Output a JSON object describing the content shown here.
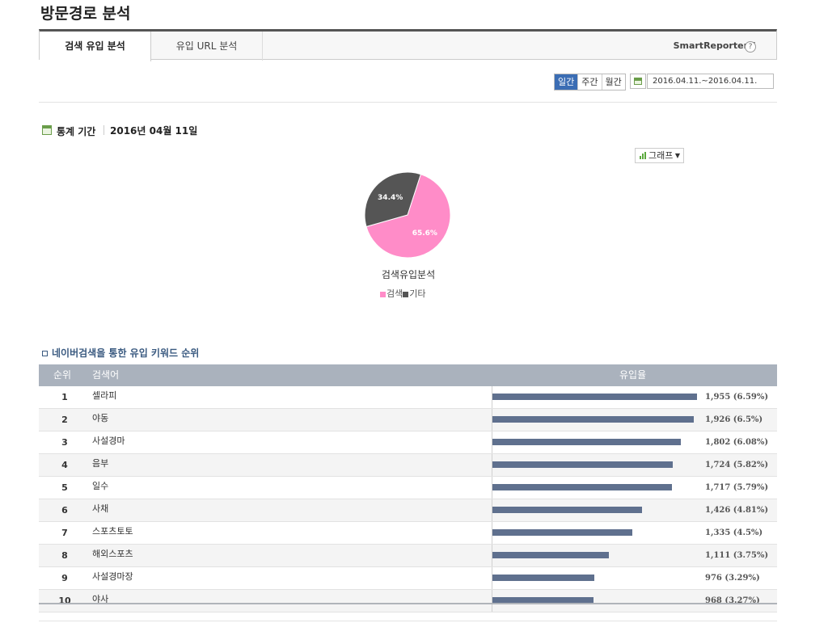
{
  "page": {
    "title": "방문경로 분석"
  },
  "tabs": [
    {
      "label": "검색 유입 분석",
      "active": true
    },
    {
      "label": "유입 URL 분석",
      "active": false
    }
  ],
  "smart_reporter": {
    "label": "SmartReporter™",
    "help": "?"
  },
  "period": {
    "buttons": [
      {
        "label": "일간",
        "selected": true
      },
      {
        "label": "주간",
        "selected": false
      },
      {
        "label": "월간",
        "selected": false
      }
    ],
    "date_range": "2016.04.11.~2016.04.11."
  },
  "stats": {
    "label": "통계 기간",
    "date": "2016년 04월 11일"
  },
  "graph_toggle": {
    "label": "그래프",
    "icon": "bar-chart-icon"
  },
  "chart_data": {
    "type": "pie",
    "title": "검색유입분석",
    "series": [
      {
        "name": "검색",
        "value": 65.6,
        "label": "65.6%",
        "color": "#ff8cc8"
      },
      {
        "name": "기타",
        "value": 34.4,
        "label": "34.4%",
        "color": "#555555"
      }
    ]
  },
  "keywords": {
    "title": "네이버검색을 통한 유입 키워드 순위",
    "headers": {
      "rank": "순위",
      "keyword": "검색어",
      "inflow": "유입율"
    },
    "max": 1955,
    "rows": [
      {
        "rank": "1",
        "keyword": "셀라피",
        "count": 1955,
        "label": "1,955 (6.59%)"
      },
      {
        "rank": "2",
        "keyword": "야동",
        "count": 1926,
        "label": "1,926 (6.5%)"
      },
      {
        "rank": "3",
        "keyword": "사설경마",
        "count": 1802,
        "label": "1,802 (6.08%)"
      },
      {
        "rank": "4",
        "keyword": "음부",
        "count": 1724,
        "label": "1,724 (5.82%)"
      },
      {
        "rank": "5",
        "keyword": "일수",
        "count": 1717,
        "label": "1,717 (5.79%)"
      },
      {
        "rank": "6",
        "keyword": "사채",
        "count": 1426,
        "label": "1,426 (4.81%)"
      },
      {
        "rank": "7",
        "keyword": "스포츠토토",
        "count": 1335,
        "label": "1,335 (4.5%)"
      },
      {
        "rank": "8",
        "keyword": "해외스포츠",
        "count": 1111,
        "label": "1,111 (3.75%)"
      },
      {
        "rank": "9",
        "keyword": "사설경마장",
        "count": 976,
        "label": "976 (3.29%)"
      },
      {
        "rank": "10",
        "keyword": "야사",
        "count": 968,
        "label": "968 (3.27%)"
      }
    ]
  }
}
